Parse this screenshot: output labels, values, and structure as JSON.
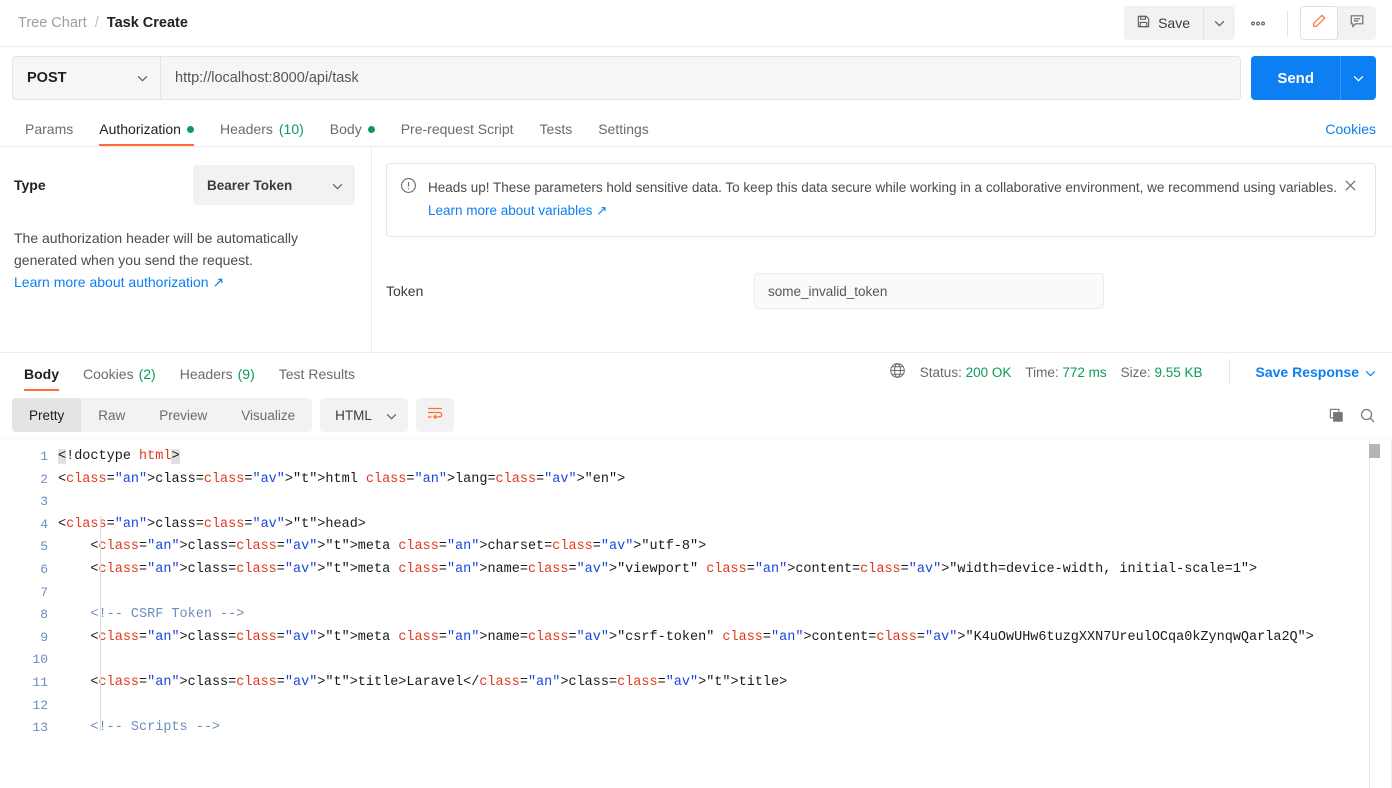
{
  "topbar": {
    "breadcrumb_parent": "Tree Chart",
    "breadcrumb_separator": "/",
    "breadcrumb_current": "Task Create",
    "save_label": "Save",
    "more_label": "000",
    "save_icon": "floppy-disk-icon",
    "caret_icon": "chevron-down-icon",
    "edit_icon": "pencil-icon",
    "comment_icon": "comment-icon",
    "accent_orange": "#ff6c37"
  },
  "request": {
    "method": "POST",
    "url": "http://localhost:8000/api/task",
    "send_label": "Send",
    "send_color": "#0c7ff2",
    "tabs": [
      {
        "label": "Params",
        "active": false,
        "dot": false,
        "count": ""
      },
      {
        "label": "Authorization",
        "active": true,
        "dot": true,
        "count": ""
      },
      {
        "label": "Headers",
        "active": false,
        "dot": false,
        "count": "(10)"
      },
      {
        "label": "Body",
        "active": false,
        "dot": true,
        "count": ""
      },
      {
        "label": "Pre-request Script",
        "active": false,
        "dot": false,
        "count": ""
      },
      {
        "label": "Tests",
        "active": false,
        "dot": false,
        "count": ""
      },
      {
        "label": "Settings",
        "active": false,
        "dot": false,
        "count": ""
      }
    ],
    "cookies_link": "Cookies"
  },
  "auth": {
    "type_label": "Type",
    "type_value": "Bearer Token",
    "description": "The authorization header will be automatically generated when you send the request.",
    "learn_link": "Learn more about authorization ↗",
    "banner_text": "Heads up! These parameters hold sensitive data. To keep this data secure while working in a collaborative environment, we recommend using variables. ",
    "banner_link": "Learn more about variables ↗",
    "banner_icon": "alert-circle-icon",
    "close_icon": "close-icon",
    "token_label": "Token",
    "token_value": "some_invalid_token"
  },
  "response": {
    "tabs": [
      {
        "label": "Body",
        "active": true,
        "count": ""
      },
      {
        "label": "Cookies",
        "active": false,
        "count": "(2)"
      },
      {
        "label": "Headers",
        "active": false,
        "count": "(9)"
      },
      {
        "label": "Test Results",
        "active": false,
        "count": ""
      }
    ],
    "globe_icon": "globe-icon",
    "status_label": "Status:",
    "status_value": "200 OK",
    "time_label": "Time:",
    "time_value": "772 ms",
    "size_label": "Size:",
    "size_value": "9.55 KB",
    "save_response": "Save Response",
    "green": "#0a9b59",
    "view_modes": [
      {
        "label": "Pretty",
        "active": true
      },
      {
        "label": "Raw",
        "active": false
      },
      {
        "label": "Preview",
        "active": false
      },
      {
        "label": "Visualize",
        "active": false
      }
    ],
    "format": "HTML",
    "wrap_icon": "word-wrap-icon",
    "copy_icon": "copy-icon",
    "search_icon": "search-icon"
  },
  "code": {
    "line_numbers": [
      "1",
      "2",
      "3",
      "4",
      "5",
      "6",
      "7",
      "8",
      "9",
      "10",
      "11",
      "12",
      "13"
    ],
    "lines": [
      "<!doctype html>",
      "<html lang=\"en\">",
      "",
      "<head>",
      "    <meta charset=\"utf-8\">",
      "    <meta name=\"viewport\" content=\"width=device-width, initial-scale=1\">",
      "",
      "    <!-- CSRF Token -->",
      "    <meta name=\"csrf-token\" content=\"K4uOwUHw6tuzgXXN7UreulOCqa0kZynqwQarla2Q\">",
      "",
      "    <title>Laravel</title>",
      "",
      "    <!-- Scripts -->"
    ],
    "csrf_token": "K4uOwUHw6tuzgXXN7UreulOCqa0kZynqwQarla2Q",
    "page_title": "Laravel"
  }
}
